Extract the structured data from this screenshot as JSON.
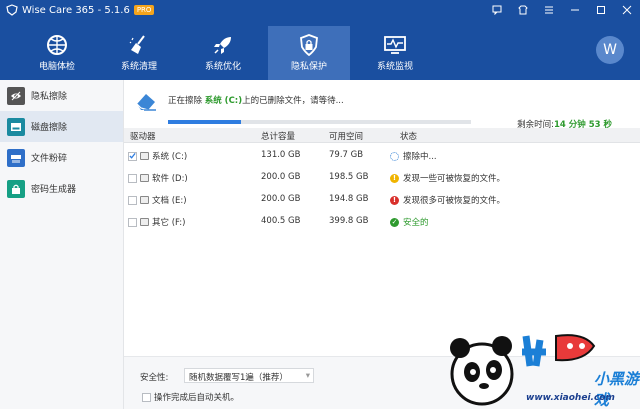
{
  "titlebar": {
    "title": "Wise Care 365 - 5.1.6",
    "badge": "PRO"
  },
  "nav": {
    "items": [
      {
        "label": "电脑体检",
        "icon": "globe-icon"
      },
      {
        "label": "系统清理",
        "icon": "broom-icon"
      },
      {
        "label": "系统优化",
        "icon": "rocket-icon"
      },
      {
        "label": "隐私保护",
        "icon": "shield-lock-icon",
        "active": true
      },
      {
        "label": "系统监视",
        "icon": "monitor-icon"
      }
    ],
    "avatar": "W"
  },
  "sidebar": {
    "items": [
      {
        "label": "隐私擦除",
        "icon": "eye-icon",
        "color": "#555555"
      },
      {
        "label": "磁盘擦除",
        "icon": "disk-icon",
        "color": "#1b8aa0",
        "active": true
      },
      {
        "label": "文件粉碎",
        "icon": "shredder-icon",
        "color": "#2f6fc8"
      },
      {
        "label": "密码生成器",
        "icon": "key-icon",
        "color": "#16a085"
      }
    ]
  },
  "status": {
    "prefix": "正在擦除",
    "drive": "系统 (C:)",
    "suffix": "上的已删除文件，请等待...",
    "progress": 0.24,
    "remaining_label": "剩余时间:",
    "remaining_value": "14 分钟 53 秒"
  },
  "table": {
    "headers": [
      "驱动器",
      "总计容量",
      "可用空间",
      "状态"
    ],
    "rows": [
      {
        "drive": "系统 (C:)",
        "total": "131.0 GB",
        "free": "79.7 GB",
        "status": "擦除中...",
        "checked": true,
        "state": "progress"
      },
      {
        "drive": "软件 (D:)",
        "total": "200.0 GB",
        "free": "198.5 GB",
        "status": "发现一些可被恢复的文件。",
        "checked": false,
        "state": "warn"
      },
      {
        "drive": "文档 (E:)",
        "total": "200.0 GB",
        "free": "194.8 GB",
        "status": "发现很多可被恢复的文件。",
        "checked": false,
        "state": "error"
      },
      {
        "drive": "其它 (F:)",
        "total": "400.5 GB",
        "free": "399.8 GB",
        "status": "安全的",
        "checked": false,
        "state": "ok"
      }
    ]
  },
  "bottom": {
    "security_label": "安全性:",
    "security_value": "随机数据覆写1遍（推荐）",
    "auto_shutdown": "操作完成后自动关机。"
  },
  "watermark": {
    "logo_text": "小黑游戏",
    "url": "www.xiaohei.com"
  },
  "colors": {
    "titlebar": "#1a4fa0",
    "accent": "#2f7de0",
    "ok": "#2e9a2e",
    "warn": "#f0b400",
    "error": "#d9302c"
  }
}
